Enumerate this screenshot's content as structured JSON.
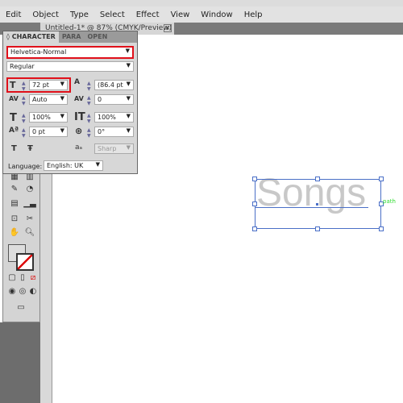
{
  "menu": [
    "Edit",
    "Object",
    "Type",
    "Select",
    "Effect",
    "View",
    "Window",
    "Help"
  ],
  "document_tab": {
    "title": "Untitled-1* @ 87% (CMYK/Preview)",
    "close": "×"
  },
  "panel": {
    "tabs": [
      "◊ CHARACTER",
      "PARA",
      "OPEN"
    ],
    "font_family": "Helvetica-Normal",
    "font_style": "Regular",
    "font_size": "72 pt",
    "leading": "(86.4 pt",
    "kerning": "Auto",
    "tracking": "0",
    "vertical_scale": "100%",
    "horizontal_scale": "100%",
    "baseline_shift": "0 pt",
    "rotation": "0°",
    "antialias": "Sharp",
    "language_label": "Language:",
    "language": "English: UK"
  },
  "canvas": {
    "text": "Songs",
    "hint": "path"
  },
  "colors": {
    "highlight": "#e0101a",
    "selection": "#4a6fc7",
    "hint": "#33dd33"
  }
}
